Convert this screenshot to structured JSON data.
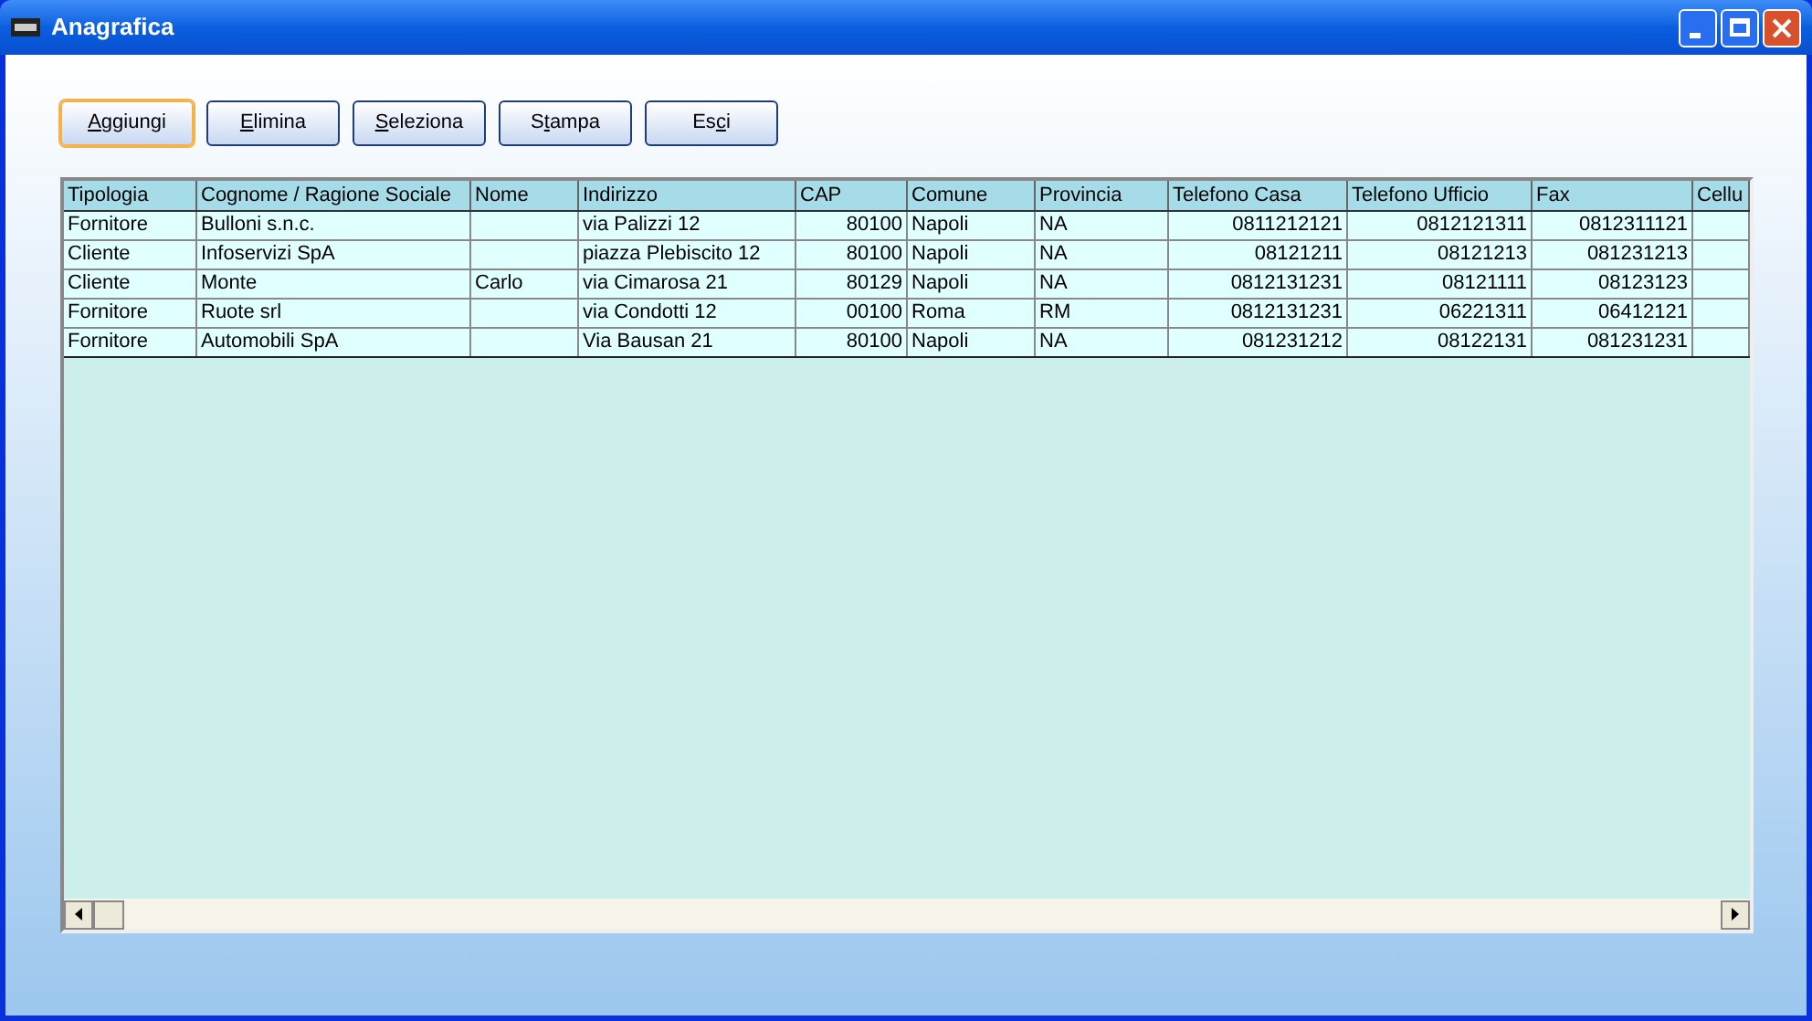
{
  "window": {
    "title": "Anagrafica"
  },
  "buttons": [
    {
      "key": "A",
      "after": "ggiungi",
      "focused": true
    },
    {
      "key": "E",
      "after": "limina",
      "focused": false
    },
    {
      "key": "S",
      "after": "eleziona",
      "focused": false
    },
    {
      "before": "S",
      "key": "t",
      "after": "ampa",
      "focused": false
    },
    {
      "before": "Es",
      "key": "c",
      "after": "i",
      "focused": false
    }
  ],
  "table": {
    "columns": [
      {
        "label": "Tipologia",
        "kind": "text"
      },
      {
        "label": "Cognome / Ragione Sociale",
        "kind": "text"
      },
      {
        "label": "Nome",
        "kind": "text"
      },
      {
        "label": "Indirizzo",
        "kind": "text"
      },
      {
        "label": "CAP",
        "kind": "number"
      },
      {
        "label": "Comune",
        "kind": "text"
      },
      {
        "label": "Provincia",
        "kind": "text"
      },
      {
        "label": "Telefono Casa",
        "kind": "number"
      },
      {
        "label": "Telefono Ufficio",
        "kind": "number"
      },
      {
        "label": "Fax",
        "kind": "number"
      },
      {
        "label": "Cellu",
        "kind": "text"
      }
    ],
    "rows": [
      [
        "Fornitore",
        "Bulloni s.n.c.",
        "",
        "via Palizzi 12",
        "80100",
        "Napoli",
        "NA",
        "0811212121",
        "0812121311",
        "0812311121",
        ""
      ],
      [
        "Cliente",
        "Infoservizi SpA",
        "",
        "piazza Plebiscito 12",
        "80100",
        "Napoli",
        "NA",
        "08121211",
        "08121213",
        "081231213",
        ""
      ],
      [
        "Cliente",
        "Monte",
        "Carlo",
        "via Cimarosa 21",
        "80129",
        "Napoli",
        "NA",
        "0812131231",
        "08121111",
        "08123123",
        ""
      ],
      [
        "Fornitore",
        "Ruote srl",
        "",
        "via Condotti 12",
        "00100",
        "Roma",
        "RM",
        "0812131231",
        "06221311",
        "06412121",
        ""
      ],
      [
        "Fornitore",
        "Automobili SpA",
        "",
        "Via Bausan 21",
        "80100",
        "Napoli",
        "NA",
        "081231212",
        "08122131",
        "081231231",
        ""
      ]
    ]
  }
}
